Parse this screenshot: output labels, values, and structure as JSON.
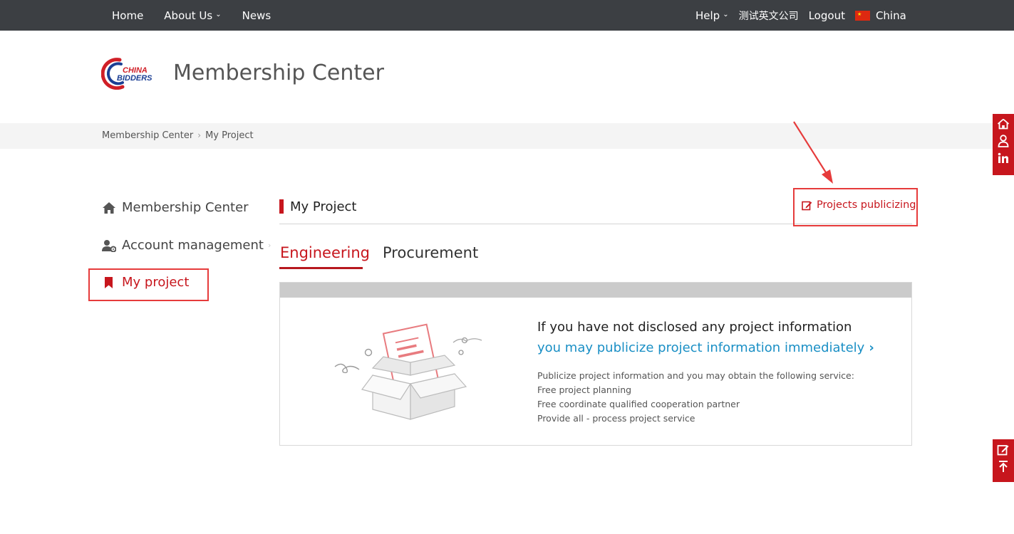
{
  "topnav": {
    "home": "Home",
    "about": "About Us",
    "news": "News",
    "help": "Help",
    "company": "测试英文公司",
    "logout": "Logout",
    "country": "China"
  },
  "header": {
    "logo_text_1": "CHINA",
    "logo_text_2": "BIDDERS",
    "title": "Membership Center"
  },
  "breadcrumb": {
    "items": [
      "Membership Center",
      "My Project"
    ]
  },
  "sidebar": {
    "items": [
      {
        "label": "Membership Center",
        "icon": "home-icon"
      },
      {
        "label": "Account management",
        "icon": "user-gear-icon"
      },
      {
        "label": "My project",
        "icon": "bookmark-icon",
        "active": true
      }
    ]
  },
  "main": {
    "section_title": "My Project",
    "publish_link": "Projects publicizing",
    "tabs": [
      {
        "label": "Engineering",
        "active": true
      },
      {
        "label": "Procurement",
        "active": false
      }
    ],
    "empty": {
      "headline": "If you have not disclosed any project information",
      "action": "you may publicize project information immediately",
      "desc": [
        "Publicize project information and you may obtain the following service:",
        "Free project planning",
        "Free coordinate qualified cooperation partner",
        "Provide all - process project service"
      ]
    }
  },
  "floating": {
    "top_icons": [
      "home-icon",
      "user-icon",
      "linkedin-icon"
    ],
    "bottom_icons": [
      "edit-icon",
      "back-to-top-icon"
    ]
  },
  "colors": {
    "brand_red": "#c7161d",
    "link_blue": "#1a8fc5",
    "topbar": "#3c3f43",
    "highlight": "#e63b3b"
  }
}
